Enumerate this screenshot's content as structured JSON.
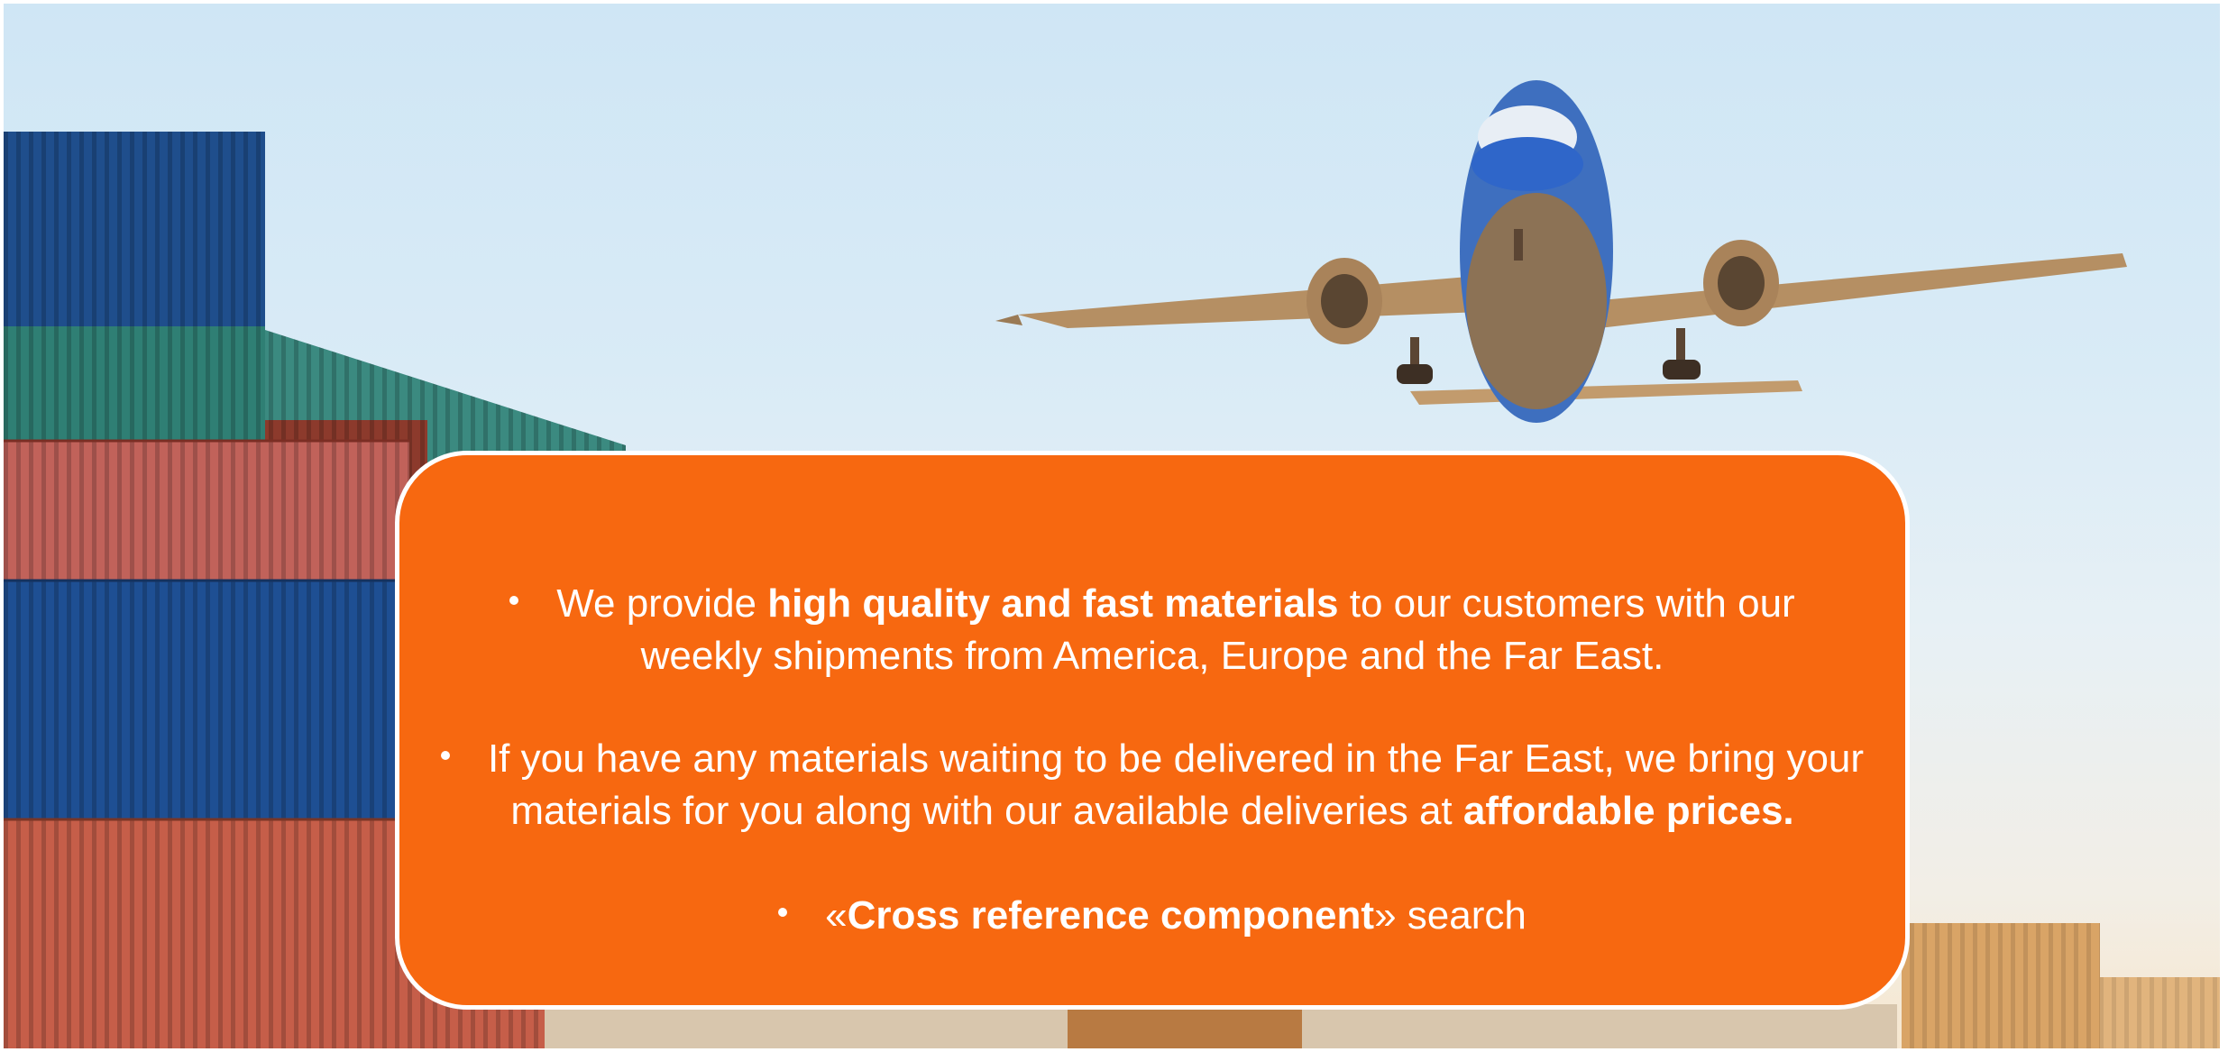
{
  "slide": {
    "background_icon": "cargo-plane-over-shipping-containers-photo",
    "accent_color": "#f76810",
    "card": {
      "bullets": [
        {
          "prefix": "We provide ",
          "bold": "high quality and fast materials",
          "suffix_line1": " to our customers with our",
          "line2": "weekly shipments from America, Europe and the Far East."
        },
        {
          "line1": "If you have any materials waiting to be delivered in the Far East, we bring your",
          "line2_prefix": "materials for you along with our available deliveries at ",
          "bold": "affordable prices."
        },
        {
          "open_quote": "«",
          "bold": "Cross reference component",
          "suffix": "» search"
        }
      ]
    }
  }
}
